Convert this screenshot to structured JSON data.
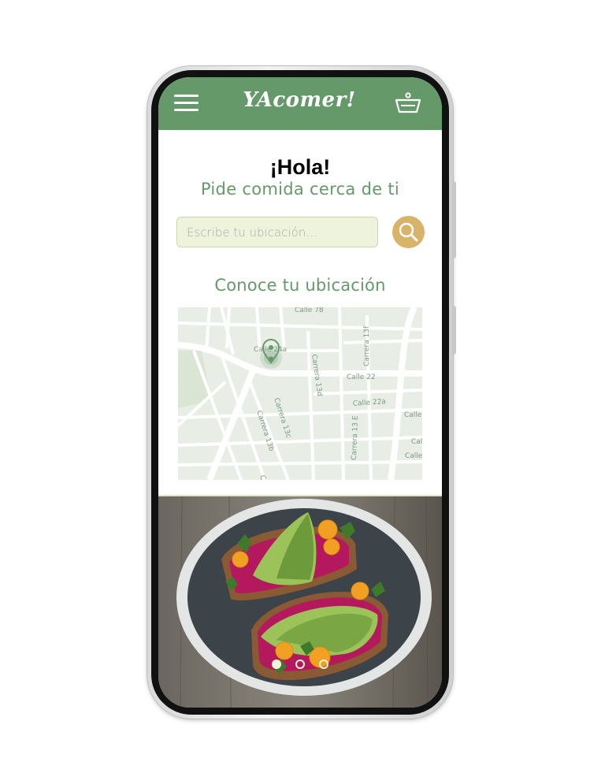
{
  "app": {
    "brand": "YAcomer!"
  },
  "header": {
    "menu_icon": "hamburger-menu-icon",
    "cart_icon": "shopping-basket-icon"
  },
  "greeting": {
    "title": "¡Hola!",
    "subtitle": "Pide comida cerca de ti"
  },
  "search": {
    "placeholder": "Escribe tu ubicación...",
    "value": "",
    "button_icon": "search-icon"
  },
  "location": {
    "title": "Conoce tu ubicación",
    "map_labels": [
      "Calle 78",
      "Calle 24a",
      "Carrera 13f",
      "Carrera 13d",
      "Calle 22",
      "Calle 22a",
      "Carrera 13c",
      "Carrera 13b",
      "Carrera 13 E",
      "Calle",
      "Calle",
      "Calle",
      "Car"
    ]
  },
  "carousel": {
    "slides": 3,
    "active_index": 0
  },
  "colors": {
    "primary_green": "#66996a",
    "accent_gold": "#d7b46a",
    "input_bg": "#eef4dc",
    "map_bg": "#e8ede6"
  }
}
